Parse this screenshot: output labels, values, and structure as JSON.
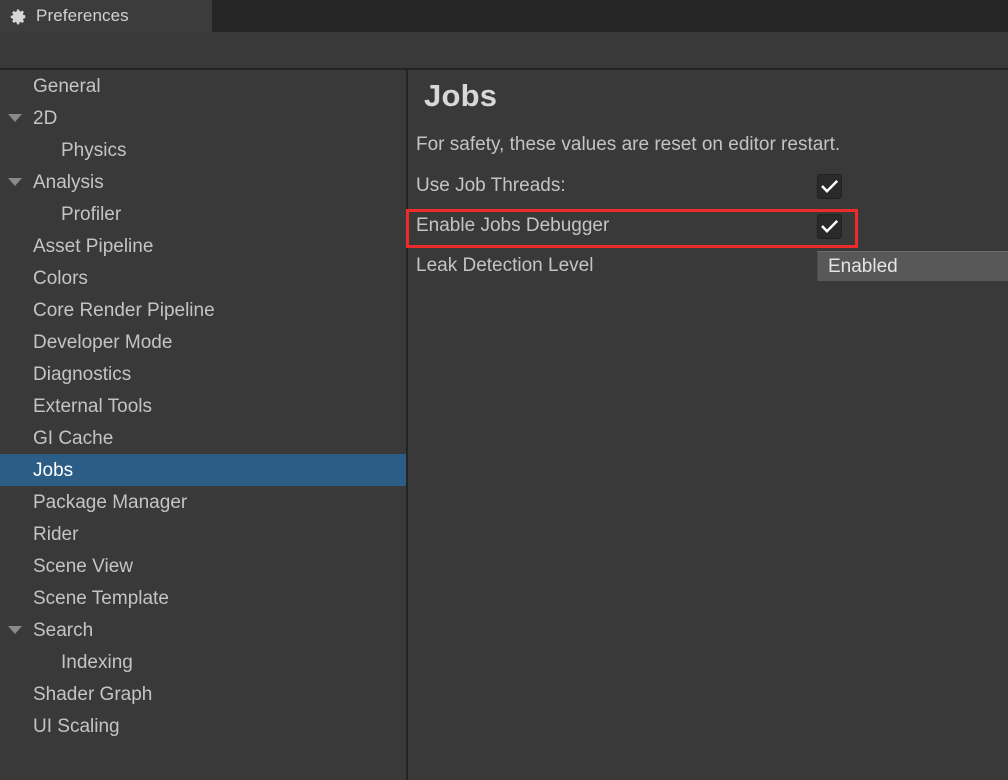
{
  "window": {
    "tab": {
      "icon": "gear-icon",
      "label": "Preferences"
    }
  },
  "sidebar": {
    "items": [
      {
        "label": "General",
        "depth": 0,
        "arrow": false,
        "selected": false
      },
      {
        "label": "2D",
        "depth": 0,
        "arrow": true,
        "selected": false
      },
      {
        "label": "Physics",
        "depth": 1,
        "arrow": false,
        "selected": false
      },
      {
        "label": "Analysis",
        "depth": 0,
        "arrow": true,
        "selected": false
      },
      {
        "label": "Profiler",
        "depth": 1,
        "arrow": false,
        "selected": false
      },
      {
        "label": "Asset Pipeline",
        "depth": 0,
        "arrow": false,
        "selected": false
      },
      {
        "label": "Colors",
        "depth": 0,
        "arrow": false,
        "selected": false
      },
      {
        "label": "Core Render Pipeline",
        "depth": 0,
        "arrow": false,
        "selected": false
      },
      {
        "label": "Developer Mode",
        "depth": 0,
        "arrow": false,
        "selected": false
      },
      {
        "label": "Diagnostics",
        "depth": 0,
        "arrow": false,
        "selected": false
      },
      {
        "label": "External Tools",
        "depth": 0,
        "arrow": false,
        "selected": false
      },
      {
        "label": "GI Cache",
        "depth": 0,
        "arrow": false,
        "selected": false
      },
      {
        "label": "Jobs",
        "depth": 0,
        "arrow": false,
        "selected": true
      },
      {
        "label": "Package Manager",
        "depth": 0,
        "arrow": false,
        "selected": false
      },
      {
        "label": "Rider",
        "depth": 0,
        "arrow": false,
        "selected": false
      },
      {
        "label": "Scene View",
        "depth": 0,
        "arrow": false,
        "selected": false
      },
      {
        "label": "Scene Template",
        "depth": 0,
        "arrow": false,
        "selected": false
      },
      {
        "label": "Search",
        "depth": 0,
        "arrow": true,
        "selected": false
      },
      {
        "label": "Indexing",
        "depth": 1,
        "arrow": false,
        "selected": false
      },
      {
        "label": "Shader Graph",
        "depth": 0,
        "arrow": false,
        "selected": false
      },
      {
        "label": "UI Scaling",
        "depth": 0,
        "arrow": false,
        "selected": false
      }
    ]
  },
  "main": {
    "title": "Jobs",
    "note": "For safety, these values are reset on editor restart.",
    "rows": {
      "use_job_threads": {
        "label": "Use Job Threads:",
        "checked": "checked"
      },
      "enable_jobs_debugger": {
        "label": "Enable Jobs Debugger",
        "checked": "checked"
      },
      "leak_detection_level": {
        "label": "Leak Detection Level",
        "value": "Enabled"
      }
    }
  },
  "annotation": {
    "color": "#ee2b2b",
    "target": "Enable Jobs Debugger"
  },
  "colors": {
    "window_background": "#393939",
    "tab_active": "#3c3c3c",
    "tab_inactive_strip": "#262626",
    "selection_blue": "#2c5d87",
    "divider": "#242424",
    "text_primary": "#c4c4c4",
    "text_selected": "#ffffff",
    "checkbox_fill": "#2a2a2a",
    "dropdown_fill": "#585858",
    "annotation_red": "#ee2b2b"
  }
}
